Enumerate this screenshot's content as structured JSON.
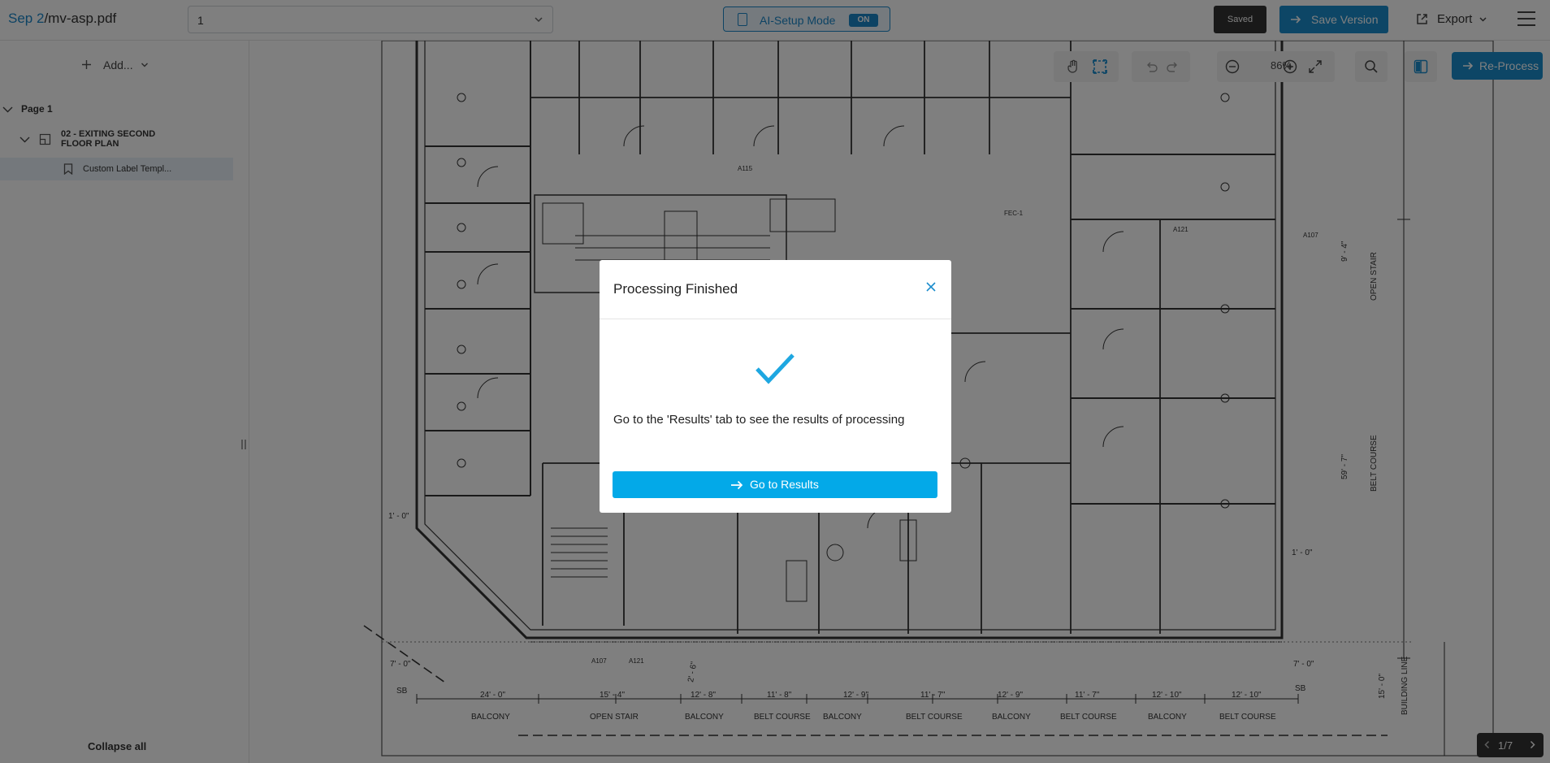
{
  "header": {
    "project": "Sep 2",
    "separator": "/",
    "filename": "mv-asp.pdf",
    "page_select_value": "1",
    "ai_mode_label": "AI-Setup Mode",
    "ai_mode_state": "ON",
    "saved_label": "Saved",
    "save_version_label": "Save Version",
    "export_label": "Export"
  },
  "sidebar": {
    "add_label": "Add...",
    "page_label": "Page 1",
    "plan_label": "02 - EXITING SECOND FLOOR PLAN",
    "template_label": "Custom Label Templ...",
    "collapse_label": "Collapse all"
  },
  "toolbar": {
    "zoom": "86%",
    "reprocess_label": "Re-Process"
  },
  "pager": {
    "label": "1/7"
  },
  "plan_labels": {
    "balcony": "BALCONY",
    "open_stair": "OPEN STAIR",
    "belt_course": "BELT COURSE",
    "sb": "SB",
    "building_line": "BUILDING LINE",
    "dims": [
      "24' - 0\"",
      "15' - 4\"",
      "12' - 8\"",
      "11' - 8\"",
      "12' - 9\"",
      "11' - 7\"",
      "12' - 9\"",
      "11' - 7\"",
      "12' - 10\"",
      "12' - 10\""
    ],
    "left_dim": "7' - 0\"",
    "right_dim": "7' - 0\"",
    "side_dim_1": "1' - 0\"",
    "side_dim_2": "1' - 0\"",
    "vertical_dim_1": "9' - 4\"",
    "vertical_dim_2": "59' - 7\"",
    "vertical_dim_3": "15' - 0\"",
    "diag_dim": "2' - 6\"",
    "tags": [
      "A115",
      "A121",
      "A107",
      "A121",
      "A107"
    ],
    "fec": "FEC-1"
  },
  "modal": {
    "title": "Processing Finished",
    "message": "Go to the 'Results' tab to see the results of processing",
    "button_label": "Go to Results"
  },
  "colors": {
    "accent": "#1a8ccd",
    "button_blue": "#03a9e8",
    "check": "#1ea7e1",
    "dark": "#333333"
  },
  "icons": {
    "ai": "tablet-icon",
    "save": "arrow-right-icon",
    "export": "external-link-icon",
    "menu": "hamburger-icon",
    "add": "plus-icon",
    "plan": "floor-plan-icon",
    "template": "bookmark-icon",
    "hand": "hand-icon",
    "select": "selection-icon",
    "undo": "undo-icon",
    "redo": "redo-icon",
    "zoom_out": "zoom-out-icon",
    "zoom_in": "zoom-in-icon",
    "fullscreen": "expand-icon",
    "search": "search-icon",
    "split": "split-view-icon",
    "close": "close-icon",
    "check": "checkmark-icon"
  }
}
